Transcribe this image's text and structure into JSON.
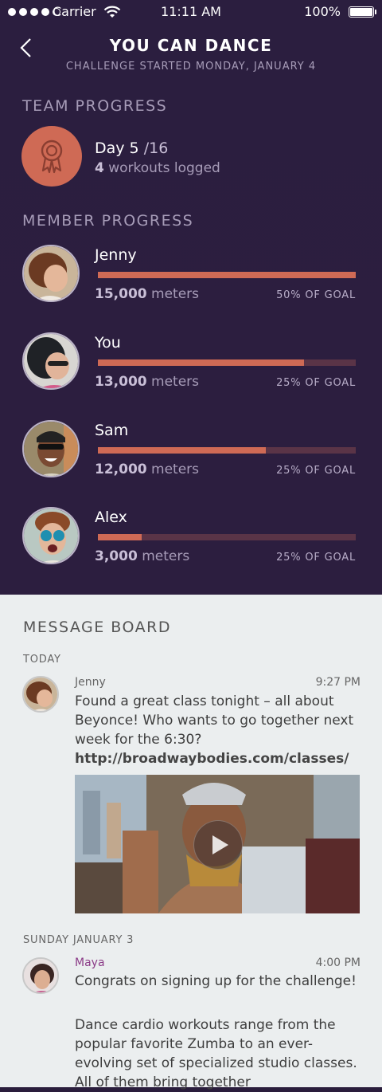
{
  "status_bar": {
    "carrier": "Carrier",
    "time": "11:11 AM",
    "battery": "100%"
  },
  "header": {
    "title": "YOU CAN DANCE",
    "subtitle": "CHALLENGE STARTED MONDAY, JANUARY 4"
  },
  "team_progress": {
    "heading": "TEAM PROGRESS",
    "day_label": "Day 5",
    "slash": "/",
    "day_total": "16",
    "workouts_count": "4",
    "workouts_label": "workouts logged"
  },
  "member_progress": {
    "heading": "MEMBER PROGRESS",
    "unit": "meters",
    "members": [
      {
        "name": "Jenny",
        "meters": "15,000",
        "goal": "50% OF GOAL",
        "progress": 1.0
      },
      {
        "name": "You",
        "meters": "13,000",
        "goal": "25% OF GOAL",
        "progress": 0.8
      },
      {
        "name": "Sam",
        "meters": "12,000",
        "goal": "25% OF GOAL",
        "progress": 0.65
      },
      {
        "name": "Alex",
        "meters": "3,000",
        "goal": "25% OF GOAL",
        "progress": 0.17
      }
    ]
  },
  "message_board": {
    "heading": "MESSAGE BOARD",
    "days": [
      {
        "label": "TODAY",
        "messages": [
          {
            "author": "Jenny",
            "time": "9:27 PM",
            "text": "Found a great class tonight – all about Beyonce! Who wants to go together next week for the 6:30?",
            "link": "http://broadwaybodies.com/classes/"
          }
        ]
      },
      {
        "label": "SUNDAY JANUARY 3",
        "messages": [
          {
            "author": "Maya",
            "time": "4:00 PM",
            "text": "Congrats on signing up for the challenge!",
            "text2": "Dance cardio workouts range from the popular favorite Zumba to an ever-evolving set of specialized studio classes. All of them bring together"
          }
        ]
      }
    ]
  },
  "colors": {
    "header_bg": "#2b1e3f",
    "accent": "#cf6a55",
    "bar_track": "#5a3447",
    "board_bg": "#ebeeef",
    "author_purple": "#8b3b87"
  }
}
